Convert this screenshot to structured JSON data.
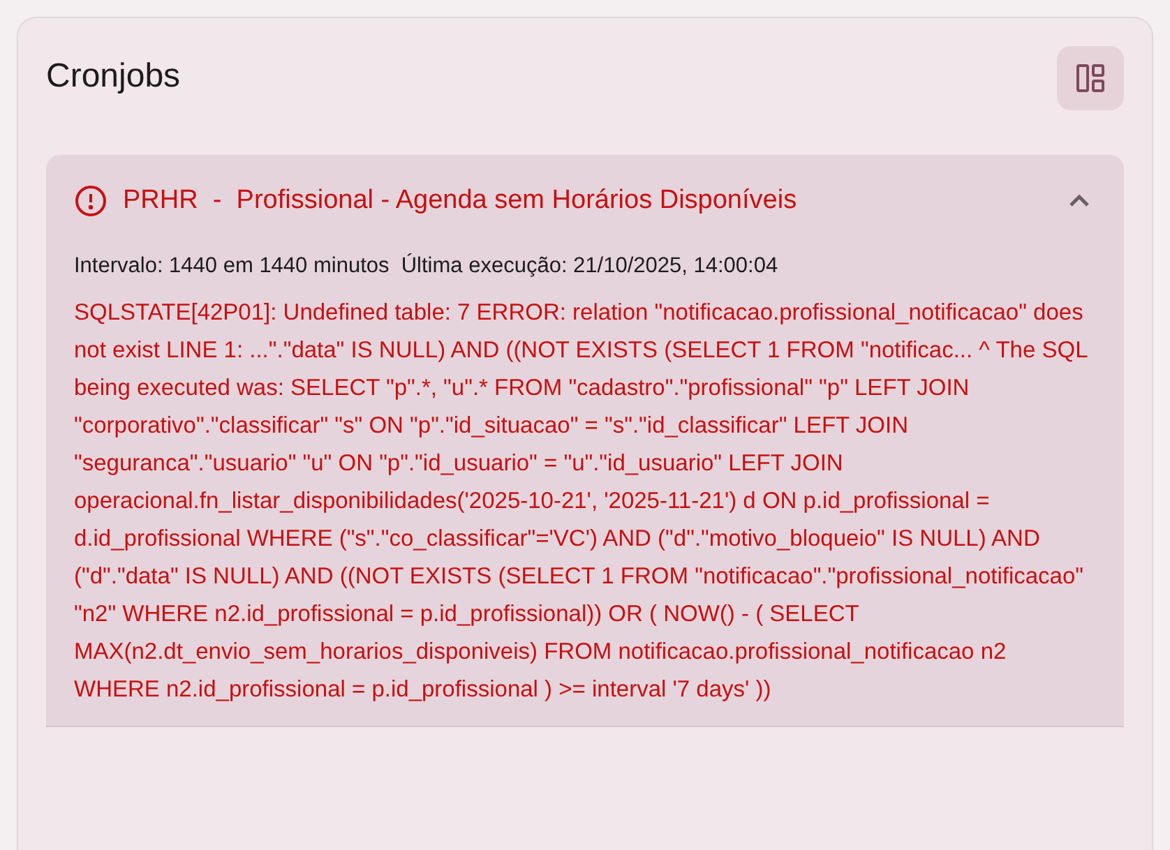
{
  "card": {
    "title": "Cronjobs"
  },
  "jobs": [
    {
      "failed": true,
      "title": "PRHR  -  Profissional - Agenda sem Horários Disponíveis",
      "expanded": true,
      "info": "Intervalo: 1440 em 1440 minutos  Última execução: 21/10/2025, 14:00:04",
      "message": "SQLSTATE[42P01]: Undefined table: 7 ERROR: relation \"notificacao.profissional_notificacao\" does not exist LINE 1: ...\".\"data\" IS NULL) AND ((NOT EXISTS (SELECT 1 FROM \"notificac... ^ The SQL being executed was: SELECT \"p\".*, \"u\".* FROM \"cadastro\".\"profissional\" \"p\" LEFT JOIN \"corporativo\".\"classificar\" \"s\" ON \"p\".\"id_situacao\" = \"s\".\"id_classificar\" LEFT JOIN \"seguranca\".\"usuario\" \"u\" ON \"p\".\"id_usuario\" = \"u\".\"id_usuario\" LEFT JOIN operacional.fn_listar_disponibilidades('2025-10-21', '2025-11-21') d ON p.id_profissional = d.id_profissional WHERE (\"s\".\"co_classificar\"='VC') AND (\"d\".\"motivo_bloqueio\" IS NULL) AND (\"d\".\"data\" IS NULL) AND ((NOT EXISTS (SELECT 1 FROM \"notificacao\".\"profissional_notificacao\" \"n2\" WHERE n2.id_profissional = p.id_profissional)) OR ( NOW() - ( SELECT MAX(n2.dt_envio_sem_horarios_disponiveis) FROM notificacao.profissional_notificacao n2 WHERE n2.id_profissional = p.id_profissional ) >= interval '7 days' ))"
    }
  ]
}
